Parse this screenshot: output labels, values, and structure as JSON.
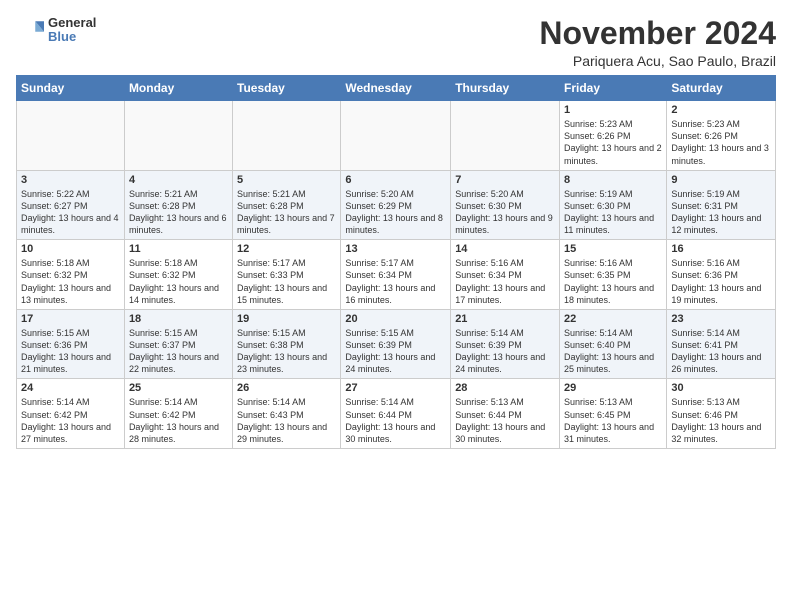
{
  "logo": {
    "general": "General",
    "blue": "Blue"
  },
  "header": {
    "month": "November 2024",
    "location": "Pariquera Acu, Sao Paulo, Brazil"
  },
  "weekdays": [
    "Sunday",
    "Monday",
    "Tuesday",
    "Wednesday",
    "Thursday",
    "Friday",
    "Saturday"
  ],
  "weeks": [
    [
      {
        "day": "",
        "empty": true
      },
      {
        "day": "",
        "empty": true
      },
      {
        "day": "",
        "empty": true
      },
      {
        "day": "",
        "empty": true
      },
      {
        "day": "",
        "empty": true
      },
      {
        "day": "1",
        "sunrise": "Sunrise: 5:23 AM",
        "sunset": "Sunset: 6:26 PM",
        "daylight": "Daylight: 13 hours and 2 minutes."
      },
      {
        "day": "2",
        "sunrise": "Sunrise: 5:23 AM",
        "sunset": "Sunset: 6:26 PM",
        "daylight": "Daylight: 13 hours and 3 minutes."
      }
    ],
    [
      {
        "day": "3",
        "sunrise": "Sunrise: 5:22 AM",
        "sunset": "Sunset: 6:27 PM",
        "daylight": "Daylight: 13 hours and 4 minutes."
      },
      {
        "day": "4",
        "sunrise": "Sunrise: 5:21 AM",
        "sunset": "Sunset: 6:28 PM",
        "daylight": "Daylight: 13 hours and 6 minutes."
      },
      {
        "day": "5",
        "sunrise": "Sunrise: 5:21 AM",
        "sunset": "Sunset: 6:28 PM",
        "daylight": "Daylight: 13 hours and 7 minutes."
      },
      {
        "day": "6",
        "sunrise": "Sunrise: 5:20 AM",
        "sunset": "Sunset: 6:29 PM",
        "daylight": "Daylight: 13 hours and 8 minutes."
      },
      {
        "day": "7",
        "sunrise": "Sunrise: 5:20 AM",
        "sunset": "Sunset: 6:30 PM",
        "daylight": "Daylight: 13 hours and 9 minutes."
      },
      {
        "day": "8",
        "sunrise": "Sunrise: 5:19 AM",
        "sunset": "Sunset: 6:30 PM",
        "daylight": "Daylight: 13 hours and 11 minutes."
      },
      {
        "day": "9",
        "sunrise": "Sunrise: 5:19 AM",
        "sunset": "Sunset: 6:31 PM",
        "daylight": "Daylight: 13 hours and 12 minutes."
      }
    ],
    [
      {
        "day": "10",
        "sunrise": "Sunrise: 5:18 AM",
        "sunset": "Sunset: 6:32 PM",
        "daylight": "Daylight: 13 hours and 13 minutes."
      },
      {
        "day": "11",
        "sunrise": "Sunrise: 5:18 AM",
        "sunset": "Sunset: 6:32 PM",
        "daylight": "Daylight: 13 hours and 14 minutes."
      },
      {
        "day": "12",
        "sunrise": "Sunrise: 5:17 AM",
        "sunset": "Sunset: 6:33 PM",
        "daylight": "Daylight: 13 hours and 15 minutes."
      },
      {
        "day": "13",
        "sunrise": "Sunrise: 5:17 AM",
        "sunset": "Sunset: 6:34 PM",
        "daylight": "Daylight: 13 hours and 16 minutes."
      },
      {
        "day": "14",
        "sunrise": "Sunrise: 5:16 AM",
        "sunset": "Sunset: 6:34 PM",
        "daylight": "Daylight: 13 hours and 17 minutes."
      },
      {
        "day": "15",
        "sunrise": "Sunrise: 5:16 AM",
        "sunset": "Sunset: 6:35 PM",
        "daylight": "Daylight: 13 hours and 18 minutes."
      },
      {
        "day": "16",
        "sunrise": "Sunrise: 5:16 AM",
        "sunset": "Sunset: 6:36 PM",
        "daylight": "Daylight: 13 hours and 19 minutes."
      }
    ],
    [
      {
        "day": "17",
        "sunrise": "Sunrise: 5:15 AM",
        "sunset": "Sunset: 6:36 PM",
        "daylight": "Daylight: 13 hours and 21 minutes."
      },
      {
        "day": "18",
        "sunrise": "Sunrise: 5:15 AM",
        "sunset": "Sunset: 6:37 PM",
        "daylight": "Daylight: 13 hours and 22 minutes."
      },
      {
        "day": "19",
        "sunrise": "Sunrise: 5:15 AM",
        "sunset": "Sunset: 6:38 PM",
        "daylight": "Daylight: 13 hours and 23 minutes."
      },
      {
        "day": "20",
        "sunrise": "Sunrise: 5:15 AM",
        "sunset": "Sunset: 6:39 PM",
        "daylight": "Daylight: 13 hours and 24 minutes."
      },
      {
        "day": "21",
        "sunrise": "Sunrise: 5:14 AM",
        "sunset": "Sunset: 6:39 PM",
        "daylight": "Daylight: 13 hours and 24 minutes."
      },
      {
        "day": "22",
        "sunrise": "Sunrise: 5:14 AM",
        "sunset": "Sunset: 6:40 PM",
        "daylight": "Daylight: 13 hours and 25 minutes."
      },
      {
        "day": "23",
        "sunrise": "Sunrise: 5:14 AM",
        "sunset": "Sunset: 6:41 PM",
        "daylight": "Daylight: 13 hours and 26 minutes."
      }
    ],
    [
      {
        "day": "24",
        "sunrise": "Sunrise: 5:14 AM",
        "sunset": "Sunset: 6:42 PM",
        "daylight": "Daylight: 13 hours and 27 minutes."
      },
      {
        "day": "25",
        "sunrise": "Sunrise: 5:14 AM",
        "sunset": "Sunset: 6:42 PM",
        "daylight": "Daylight: 13 hours and 28 minutes."
      },
      {
        "day": "26",
        "sunrise": "Sunrise: 5:14 AM",
        "sunset": "Sunset: 6:43 PM",
        "daylight": "Daylight: 13 hours and 29 minutes."
      },
      {
        "day": "27",
        "sunrise": "Sunrise: 5:14 AM",
        "sunset": "Sunset: 6:44 PM",
        "daylight": "Daylight: 13 hours and 30 minutes."
      },
      {
        "day": "28",
        "sunrise": "Sunrise: 5:13 AM",
        "sunset": "Sunset: 6:44 PM",
        "daylight": "Daylight: 13 hours and 30 minutes."
      },
      {
        "day": "29",
        "sunrise": "Sunrise: 5:13 AM",
        "sunset": "Sunset: 6:45 PM",
        "daylight": "Daylight: 13 hours and 31 minutes."
      },
      {
        "day": "30",
        "sunrise": "Sunrise: 5:13 AM",
        "sunset": "Sunset: 6:46 PM",
        "daylight": "Daylight: 13 hours and 32 minutes."
      }
    ]
  ]
}
